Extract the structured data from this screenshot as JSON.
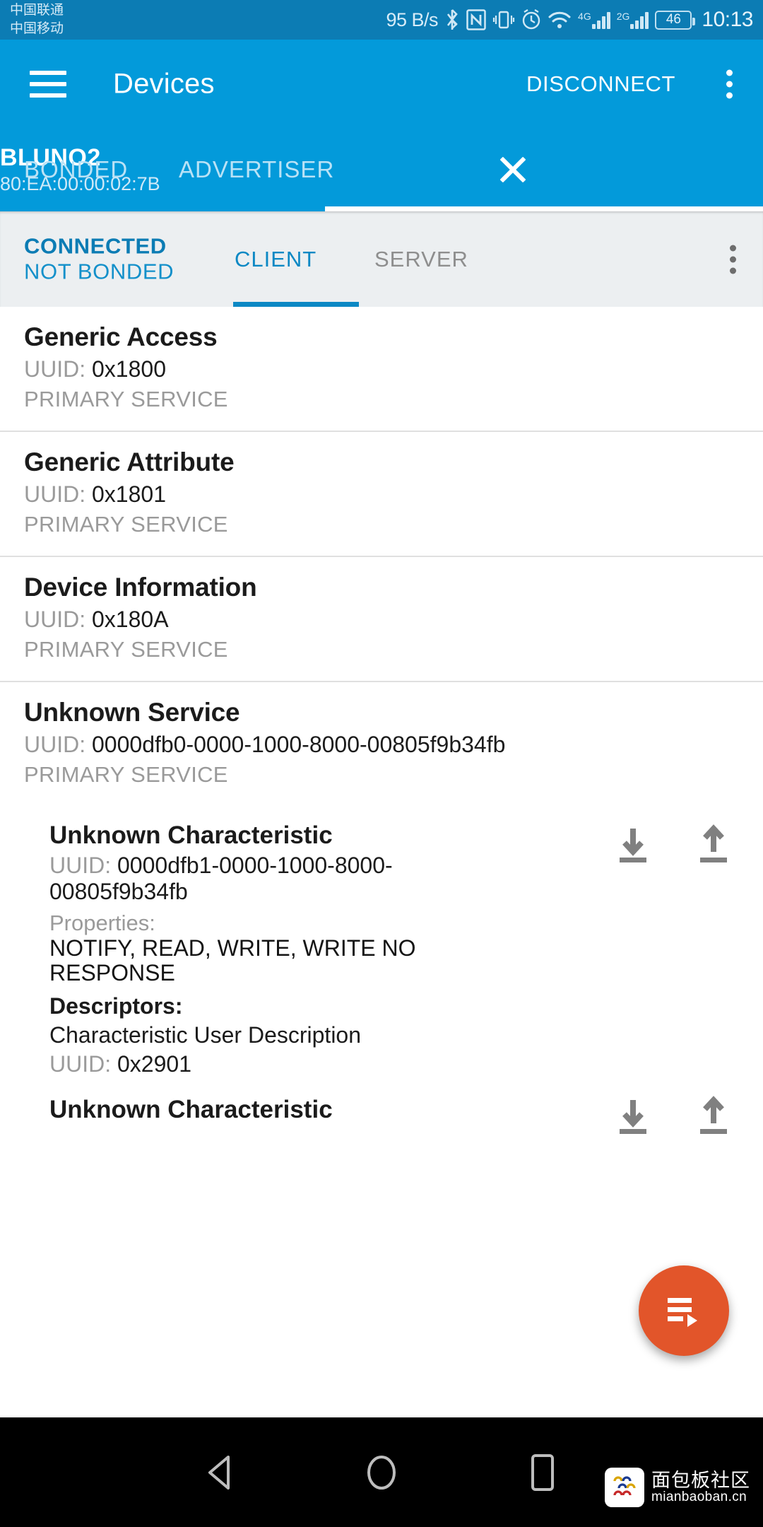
{
  "status_bar": {
    "carrier_line1": "中国联通",
    "carrier_line2": "中国移动",
    "net_rate": "95 B/s",
    "battery": "46",
    "time": "10:13",
    "net_4g": "4G",
    "net_2g": "2G",
    "icons": [
      "bluetooth-icon",
      "nfc-icon",
      "vibrate-icon",
      "alarm-icon",
      "wifi-icon",
      "signal-4g-icon",
      "signal-2g-icon",
      "battery-icon"
    ]
  },
  "app_bar": {
    "title": "Devices",
    "disconnect_label": "DISCONNECT",
    "menu_icon": "hamburger-icon",
    "overflow_icon": "kebab-menu-icon"
  },
  "top_tabs": {
    "bonded": "BONDED",
    "advertiser": "ADVERTISER",
    "device_name": "BLUNO2",
    "device_address": "80:EA:00:00:02:7B",
    "close_icon": "close-icon",
    "active_index": 2
  },
  "connection": {
    "state": "CONNECTED",
    "bond_state": "NOT BONDED",
    "tabs": [
      "CLIENT",
      "SERVER"
    ],
    "active_tab": "CLIENT",
    "overflow_icon": "kebab-menu-icon"
  },
  "services": [
    {
      "title": "Generic Access",
      "uuid_label": "UUID:",
      "uuid": "0x1800",
      "type": "PRIMARY SERVICE",
      "characteristics": []
    },
    {
      "title": "Generic Attribute",
      "uuid_label": "UUID:",
      "uuid": "0x1801",
      "type": "PRIMARY SERVICE",
      "characteristics": []
    },
    {
      "title": "Device Information",
      "uuid_label": "UUID:",
      "uuid": "0x180A",
      "type": "PRIMARY SERVICE",
      "characteristics": []
    },
    {
      "title": "Unknown Service",
      "uuid_label": "UUID:",
      "uuid": "0000dfb0-0000-1000-8000-00805f9b34fb",
      "type": "PRIMARY SERVICE",
      "characteristics": [
        {
          "title": "Unknown Characteristic",
          "uuid_label": "UUID:",
          "uuid": "0000dfb1-0000-1000-8000-00805f9b34fb",
          "properties_label": "Properties:",
          "properties": "NOTIFY, READ, WRITE, WRITE NO RESPONSE",
          "descriptors_label": "Descriptors:",
          "descriptor_name": "Characteristic User Description",
          "descriptor_uuid_label": "UUID:",
          "descriptor_uuid": "0x2901",
          "read_icon": "download-icon",
          "write_icon": "upload-icon"
        },
        {
          "title": "Unknown Characteristic",
          "read_icon": "download-icon",
          "write_icon": "upload-icon"
        }
      ]
    }
  ],
  "fab": {
    "icon": "playlist-play-icon",
    "color": "#e2552a"
  },
  "nav_bar": {
    "back_icon": "triangle-back-icon",
    "home_icon": "circle-home-icon",
    "recents_icon": "square-recents-icon"
  },
  "watermark": {
    "cn": "面包板社区",
    "en": "mianbaoban.cn"
  },
  "colors": {
    "primary": "#039ada",
    "status_bar": "#0c7cb4",
    "accent": "#0c88c4",
    "fab": "#e2552a"
  }
}
